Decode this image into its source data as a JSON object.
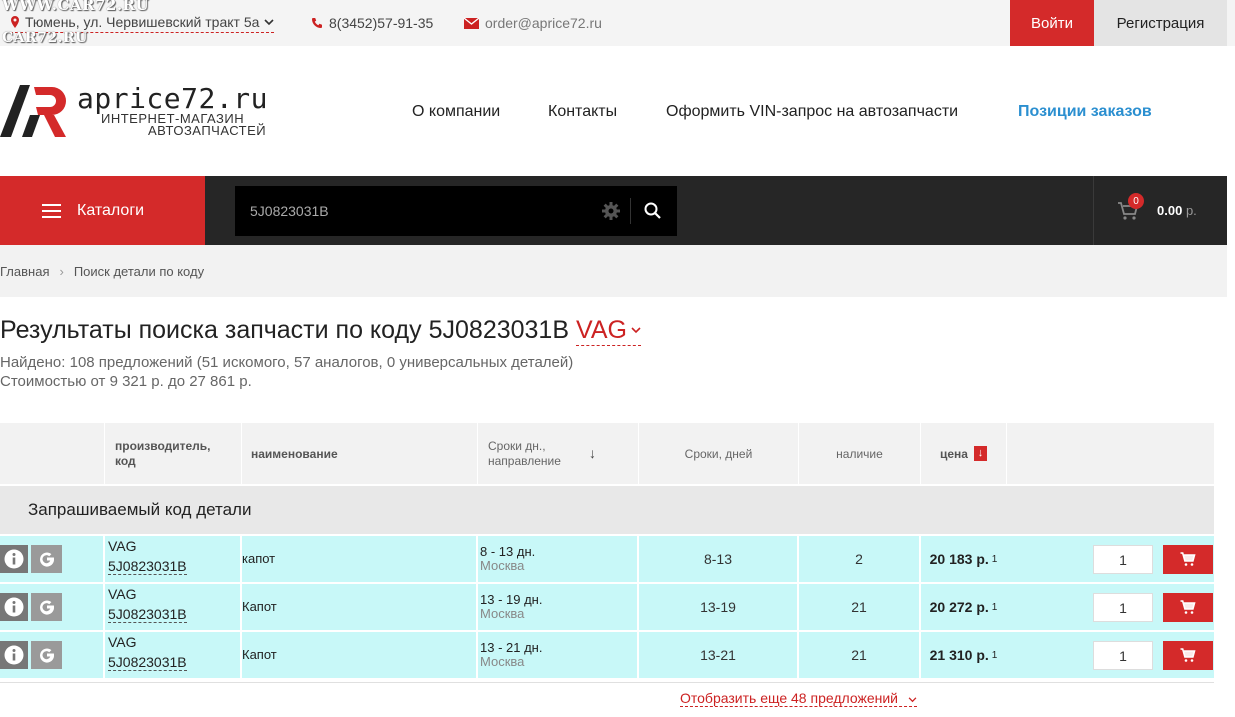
{
  "watermark": {
    "line1": "WWW.CAR72.RU",
    "line2": "CAR72.RU"
  },
  "topbar": {
    "city": "Тюмень, ул. Червишевский тракт 5а",
    "phone": "8(3452)57-91-35",
    "email": "order@aprice72.ru",
    "login_label": "Войти",
    "register_label": "Регистрация"
  },
  "header": {
    "logo_name": "aprice72.ru",
    "logo_sub1": "ИНТЕРНЕТ-МАГАЗИН",
    "logo_sub2": "АВТОЗАПЧАСТЕЙ",
    "nav": [
      "О компании",
      "Контакты",
      "Оформить VIN-запрос на автозапчасти",
      "Позиции заказов"
    ]
  },
  "toolbar": {
    "catalog_label": "Каталоги",
    "search_value": "5J0823031B",
    "cart_count": "0",
    "cart_total": "0.00",
    "cart_currency": "р."
  },
  "breadcrumb": [
    "Главная",
    "Поиск детали по коду"
  ],
  "results": {
    "title_prefix": "Результаты поиска запчасти по коду",
    "code": "5J0823031B",
    "brand": "VAG",
    "found": "Найдено: 108 предложений (51 искомого, 57 аналогов, 0 универсальных деталей)",
    "price_range": "Стоимостью от 9 321 р. до 27 861 р."
  },
  "table": {
    "headers": {
      "manufacturer": "производитель, код",
      "name": "наименование",
      "terms_direction": "Сроки дн., направление",
      "terms": "Сроки, дней",
      "stock": "наличие",
      "price": "цена"
    },
    "section_title": "Запрашиваемый код детали",
    "rows": [
      {
        "brand": "VAG",
        "code": "5J0823031B",
        "name": "капот",
        "term": "8 - 13 дн.",
        "city": "Москва",
        "days": "8-13",
        "stock": "2",
        "price": "20 183 р.",
        "note": "1",
        "qty": "1"
      },
      {
        "brand": "VAG",
        "code": "5J0823031B",
        "name": "Капот",
        "term": "13 - 19 дн.",
        "city": "Москва",
        "days": "13-19",
        "stock": "21",
        "price": "20 272 р.",
        "note": "1",
        "qty": "1"
      },
      {
        "brand": "VAG",
        "code": "5J0823031B",
        "name": "Капот",
        "term": "13 - 21 дн.",
        "city": "Москва",
        "days": "13-21",
        "stock": "21",
        "price": "21 310 р.",
        "note": "1",
        "qty": "1"
      }
    ],
    "more_label": "Отобразить еще 48 предложений"
  }
}
